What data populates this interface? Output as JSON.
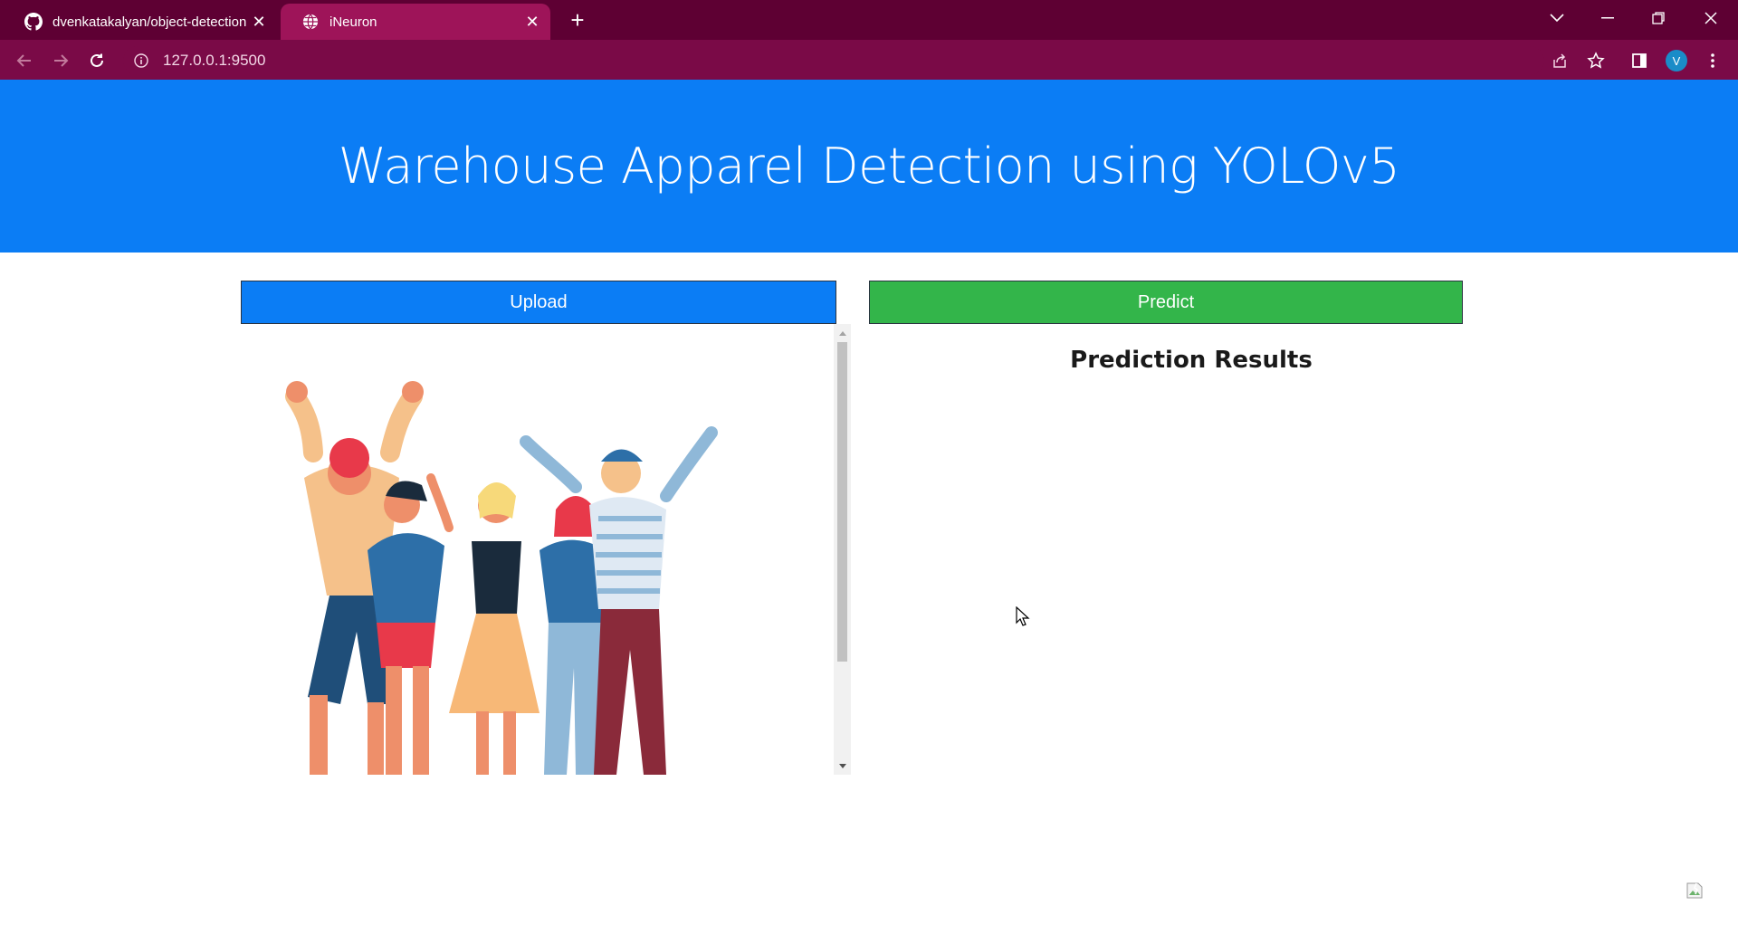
{
  "browser": {
    "tabs": [
      {
        "title": "dvenkatakalyan/object-detection",
        "icon": "github-icon",
        "active": false
      },
      {
        "title": "iNeuron",
        "icon": "globe-icon",
        "active": true
      }
    ],
    "url": "127.0.0.1:9500",
    "profile_initial": "V"
  },
  "page": {
    "heading": "Warehouse Apparel Detection using YOLOv5",
    "upload_label": "Upload",
    "predict_label": "Predict",
    "results_title": "Prediction Results",
    "uploaded_image": "people-celebrating-illustration"
  },
  "colors": {
    "hero": "#0b7df5",
    "upload": "#0b7df5",
    "predict": "#33b54a",
    "tabbar": "#5e0033",
    "addressbar": "#7a0a47"
  }
}
